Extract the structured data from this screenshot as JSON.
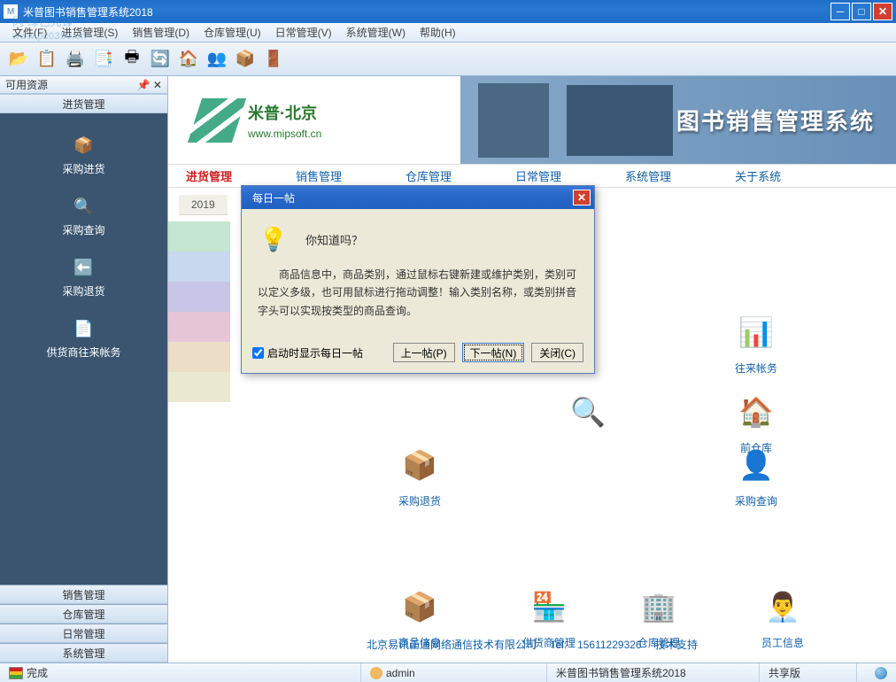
{
  "window": {
    "title": "米普图书销售管理系统2018",
    "watermark_line1": "冈 绿色先锋",
    "watermark_line2": "www.pc0359.cn"
  },
  "menu": {
    "items": [
      "文件(F)",
      "进货管理(S)",
      "销售管理(D)",
      "仓库管理(U)",
      "日常管理(V)",
      "系统管理(W)",
      "帮助(H)"
    ]
  },
  "sidebar": {
    "header": "可用资源",
    "active_panel": "进货管理",
    "items": [
      {
        "icon": "📦",
        "label": "采购进货"
      },
      {
        "icon": "🔍",
        "label": "采购查询"
      },
      {
        "icon": "⬅️",
        "label": "采购退货"
      },
      {
        "icon": "📄",
        "label": "供货商往来帐务"
      }
    ],
    "bottom_panels": [
      "销售管理",
      "仓库管理",
      "日常管理",
      "系统管理"
    ]
  },
  "banner": {
    "brand": "米普·北京",
    "url": "www.mipsoft.cn",
    "title": "图书销售管理系统"
  },
  "tabs": [
    {
      "label": "进货管理",
      "active": true
    },
    {
      "label": "销售管理",
      "active": false
    },
    {
      "label": "仓库管理",
      "active": false
    },
    {
      "label": "日常管理",
      "active": false
    },
    {
      "label": "系统管理",
      "active": false
    },
    {
      "label": "关于系统",
      "active": false
    }
  ],
  "year": "2019",
  "grid": {
    "r1": {
      "icon": "📊",
      "label": "往来帐务"
    },
    "r2": {
      "icon": "🏠",
      "label": "前仓库"
    },
    "r3": {
      "icon": "📦",
      "label": "采购退货"
    },
    "r4": {
      "icon": "🔍",
      "label": ""
    },
    "r5": {
      "icon": "👤",
      "label": "采购查询"
    },
    "r6": {
      "icon": "📦",
      "label": "商品信息"
    },
    "r7": {
      "icon": "🏪",
      "label": "供货商管理"
    },
    "r8": {
      "icon": "🏢",
      "label": "仓库管理"
    },
    "r9": {
      "icon": "👨‍💼",
      "label": "员工信息"
    }
  },
  "footer": {
    "company": "北京易讯正通网络通信技术有限公司",
    "tel_label": "Tel:",
    "tel": "15611229326",
    "support": "技术支持"
  },
  "status": {
    "done": "完成",
    "user": "admin",
    "app": "米普图书销售管理系统2018",
    "version": "共享版"
  },
  "dialog": {
    "title": "每日一帖",
    "question": "你知道吗？",
    "body": "商品信息中，商品类别，通过鼠标右键新建或维护类别，类别可以定义多级，也可用鼠标进行拖动调整！输入类别名称，或类别拼音字头可以实现按类型的商品查询。",
    "checkbox": "启动时显示每日一帖",
    "btn_prev": "上一帖(P)",
    "btn_next": "下一帖(N)",
    "btn_close": "关闭(C)"
  },
  "tool_icons": [
    "📂",
    "📋",
    "🖨️",
    "📑",
    "🖶",
    "🔄",
    "🏠",
    "👥",
    "📦",
    "🚪"
  ]
}
